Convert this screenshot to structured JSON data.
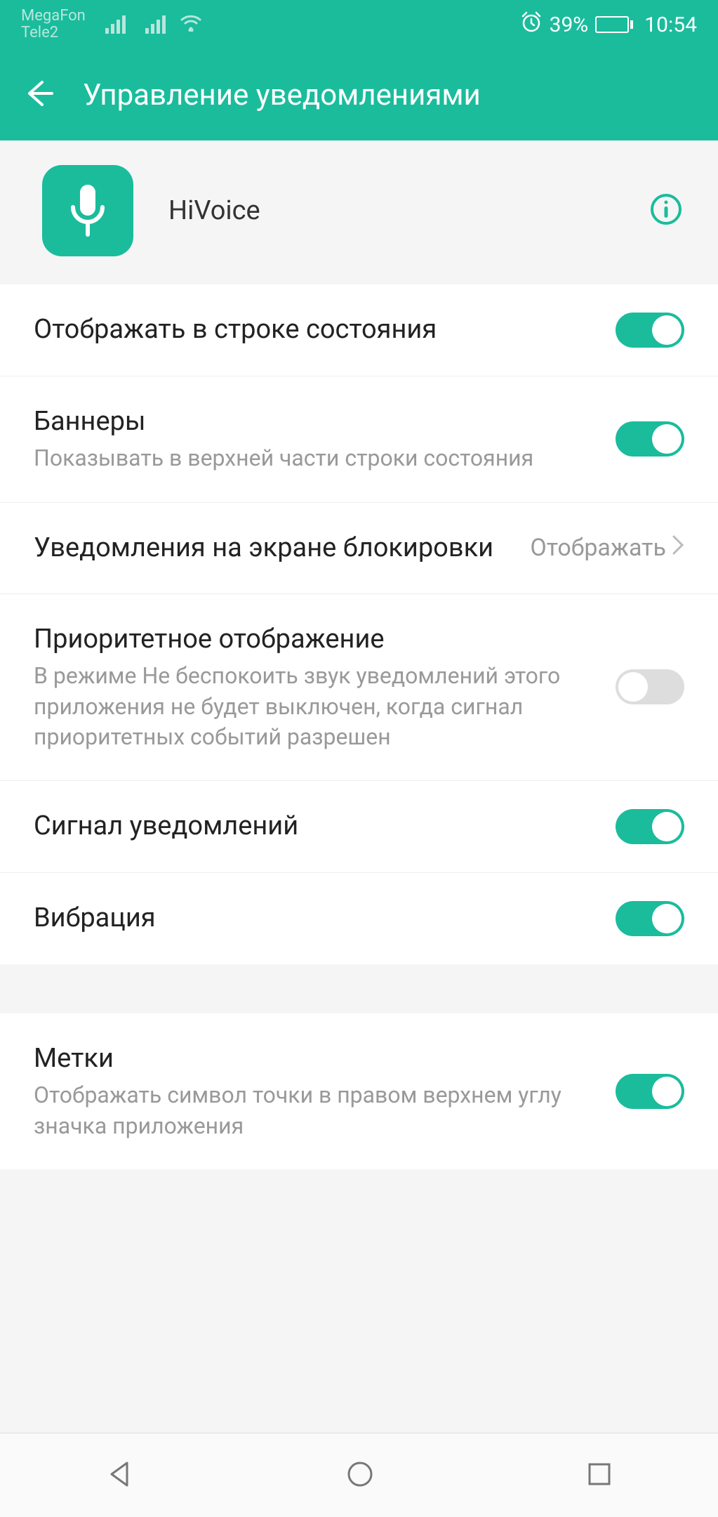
{
  "status": {
    "carrier1": "MegaFon",
    "carrier2": "Tele2",
    "battery_pct": "39%",
    "time": "10:54"
  },
  "header": {
    "title": "Управление уведомлениями"
  },
  "app": {
    "name": "HiVoice"
  },
  "settings": [
    {
      "title": "Отображать в строке состояния",
      "subtitle": "",
      "type": "toggle",
      "value": true
    },
    {
      "title": "Баннеры",
      "subtitle": "Показывать в верхней части строки состояния",
      "type": "toggle",
      "value": true
    },
    {
      "title": "Уведомления на экране блокировки",
      "subtitle": "",
      "type": "link",
      "link_value": "Отображать"
    },
    {
      "title": "Приоритетное отображение",
      "subtitle": "В режиме Не беспокоить звук уведомлений этого приложения не будет выключен, когда сигнал приоритетных событий разрешен",
      "type": "toggle",
      "value": false
    },
    {
      "title": "Сигнал уведомлений",
      "subtitle": "",
      "type": "toggle",
      "value": true
    },
    {
      "title": "Вибрация",
      "subtitle": "",
      "type": "toggle",
      "value": true
    }
  ],
  "settings2": [
    {
      "title": "Метки",
      "subtitle": "Отображать символ точки в правом верхнем углу значка приложения",
      "type": "toggle",
      "value": true
    }
  ]
}
